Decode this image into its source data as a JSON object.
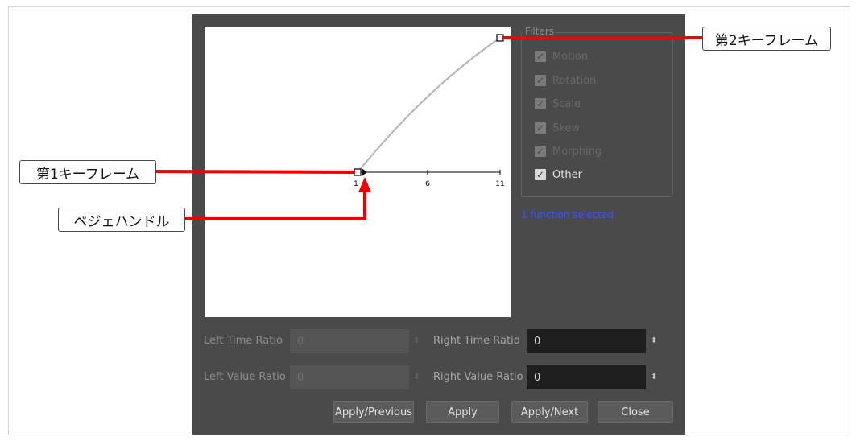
{
  "filters": {
    "title": "Filters",
    "items": [
      {
        "label": "Motion",
        "checked": true,
        "enabled": false
      },
      {
        "label": "Rotation",
        "checked": true,
        "enabled": false
      },
      {
        "label": "Scale",
        "checked": true,
        "enabled": false
      },
      {
        "label": "Skew",
        "checked": true,
        "enabled": false
      },
      {
        "label": "Morphing",
        "checked": true,
        "enabled": false
      },
      {
        "label": "Other",
        "checked": true,
        "enabled": true
      }
    ]
  },
  "selection_info": "1 function selected",
  "graph": {
    "ticks": [
      "1",
      "6",
      "11"
    ]
  },
  "ratios": {
    "left_time_label": "Left Time Ratio",
    "left_time_value": "0",
    "left_value_label": "Left Value Ratio",
    "left_value_value": "0",
    "right_time_label": "Right Time Ratio",
    "right_time_value": "0",
    "right_value_label": "Right Value Ratio",
    "right_value_value": "0"
  },
  "buttons": {
    "apply_previous": "Apply/Previous",
    "apply": "Apply",
    "apply_next": "Apply/Next",
    "close": "Close"
  },
  "annotations": {
    "keyframe1": "第1キーフレーム",
    "keyframe2": "第2キーフレーム",
    "bezier_handle": "ベジェハンドル"
  },
  "colors": {
    "dialog_bg": "#4a4a4a",
    "annotation_line": "#ee0000",
    "selected_text": "#3355ff"
  }
}
